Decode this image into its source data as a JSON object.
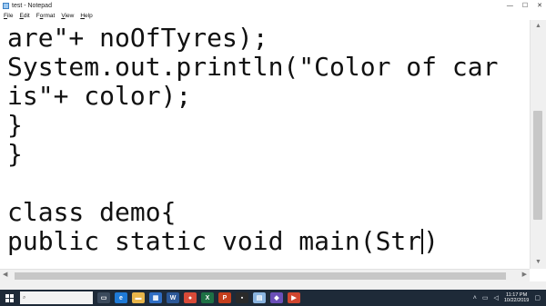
{
  "window": {
    "title": "test - Notepad",
    "minimize": "—",
    "maximize": "☐",
    "close": "✕"
  },
  "menu": [
    {
      "key": "F",
      "rest": "ile"
    },
    {
      "key": "E",
      "rest": "dit"
    },
    {
      "key": "o",
      "pre": "F",
      "rest": "rmat"
    },
    {
      "key": "V",
      "rest": "iew"
    },
    {
      "key": "H",
      "rest": "elp"
    }
  ],
  "menu_labels": [
    "File",
    "Edit",
    "Format",
    "View",
    "Help"
  ],
  "editor": {
    "lines": [
      "are\"+ noOfTyres);",
      "System.out.println(\"Color of car",
      "is\"+ color);",
      "}",
      "}",
      "",
      "class demo{",
      "public static void main(Str",
      ")"
    ]
  },
  "taskbar": {
    "search_placeholder": "",
    "icons": [
      {
        "name": "task-view-icon",
        "glyph": "▭",
        "color": "#3b4a5c"
      },
      {
        "name": "edge-icon",
        "glyph": "e",
        "color": "#1f7ad6"
      },
      {
        "name": "file-explorer-icon",
        "glyph": "▬",
        "color": "#e8b54a"
      },
      {
        "name": "store-icon",
        "glyph": "▦",
        "color": "#2f6ec4"
      },
      {
        "name": "word-icon",
        "glyph": "W",
        "color": "#2b5797"
      },
      {
        "name": "chrome-icon",
        "glyph": "●",
        "color": "#d84a38"
      },
      {
        "name": "excel-icon",
        "glyph": "X",
        "color": "#1e7145"
      },
      {
        "name": "powerpoint-icon",
        "glyph": "P",
        "color": "#c43e1c"
      },
      {
        "name": "cmd-icon",
        "glyph": "▪",
        "color": "#2a2a2a"
      },
      {
        "name": "notepad-icon",
        "glyph": "▤",
        "color": "#8ab4e0"
      },
      {
        "name": "app-icon",
        "glyph": "◆",
        "color": "#6b4fb8"
      },
      {
        "name": "media-icon",
        "glyph": "▶",
        "color": "#d0462f"
      }
    ],
    "clock_time": "11:17 PM",
    "clock_date": "10/22/2019"
  }
}
